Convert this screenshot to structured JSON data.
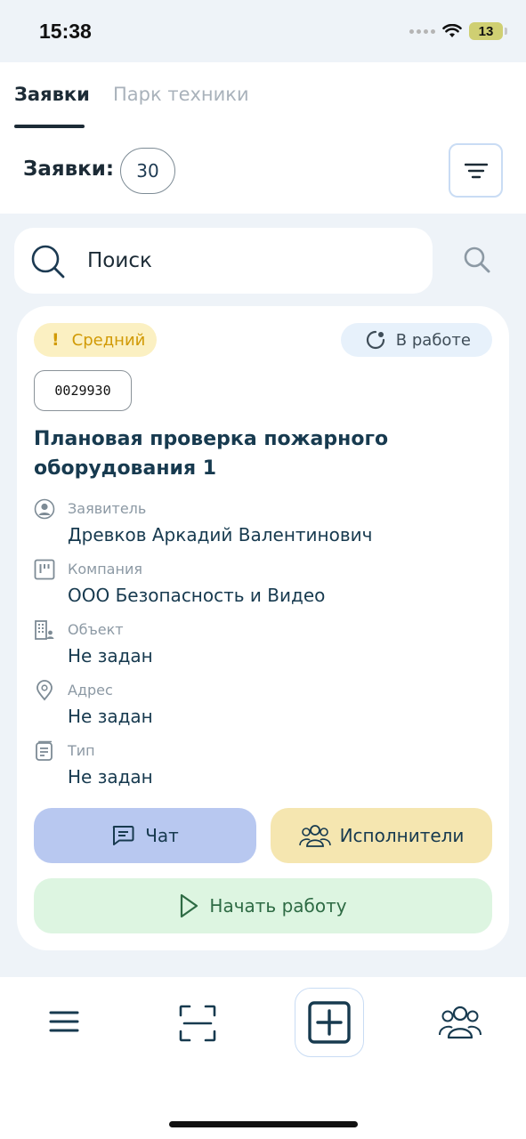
{
  "status_bar": {
    "time": "15:38",
    "battery": "13"
  },
  "tabs": [
    {
      "label": "Заявки",
      "active": true
    },
    {
      "label": "Парк техники",
      "active": false
    }
  ],
  "requests": {
    "label": "Заявки:",
    "count": "30"
  },
  "search": {
    "placeholder": "Поиск"
  },
  "card": {
    "priority": "Средний",
    "priority_mark": "!",
    "status": "В работе",
    "id": "0029930",
    "title": "Плановая проверка пожарного оборудования 1",
    "fields": [
      {
        "label": "Заявитель",
        "value": "Древков Аркадий Валентинович",
        "icon": "user-circle-icon"
      },
      {
        "label": "Компания",
        "value": "ООО Безопасность и Видео",
        "icon": "company-icon"
      },
      {
        "label": "Объект",
        "value": "Не задан",
        "icon": "building-icon"
      },
      {
        "label": "Адрес",
        "value": "Не задан",
        "icon": "location-pin-icon"
      },
      {
        "label": "Тип",
        "value": "Не задан",
        "icon": "document-type-icon"
      }
    ],
    "buttons": {
      "chat": "Чат",
      "executors": "Исполнители",
      "start": "Начать работу"
    }
  },
  "colors": {
    "background": "#eef3f8",
    "title": "#173a4f",
    "priority_bg": "#fbf0c2",
    "priority_text": "#d19a05",
    "status_bg": "#e7f1fb",
    "chat_bg": "#b8c8f0",
    "executors_bg": "#f5e6b0",
    "start_bg": "#ddf5e1",
    "start_text": "#2e6b44"
  }
}
